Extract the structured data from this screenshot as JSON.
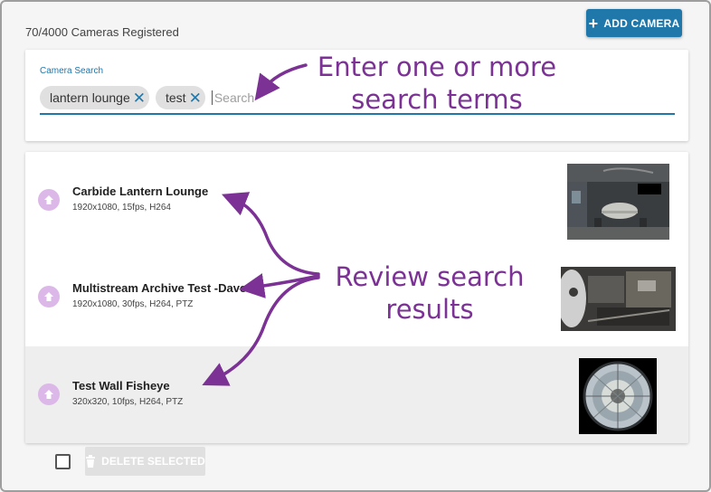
{
  "header": {
    "camera_count": "70/4000 Cameras Registered",
    "add_button_label": "ADD CAMERA",
    "add_icon": "plus-icon"
  },
  "search": {
    "label": "Camera Search",
    "placeholder": "Search",
    "chips": [
      {
        "text": "lantern lounge",
        "remove_icon": "close-icon"
      },
      {
        "text": "test",
        "remove_icon": "close-icon"
      }
    ]
  },
  "results": [
    {
      "name": "Carbide Lantern Lounge",
      "details": "1920x1080, 15fps, H264",
      "selected": false
    },
    {
      "name": "Multistream Archive Test -Dave",
      "details": "1920x1080, 30fps, H264, PTZ",
      "selected": false
    },
    {
      "name": "Test Wall Fisheye",
      "details": "320x320, 10fps, H264, PTZ",
      "selected": true
    }
  ],
  "footer": {
    "delete_button_label": "DELETE SELECTED",
    "delete_icon": "trash-icon"
  },
  "annotations": {
    "search_line1": "Enter one or more",
    "search_line2": "search terms",
    "review_line1": "Review search",
    "review_line2": "results"
  },
  "colors": {
    "accent": "#1f77aa",
    "annotation": "#7b3294",
    "row_icon": "#dcb8e8",
    "selected_row": "#eeeeee"
  }
}
